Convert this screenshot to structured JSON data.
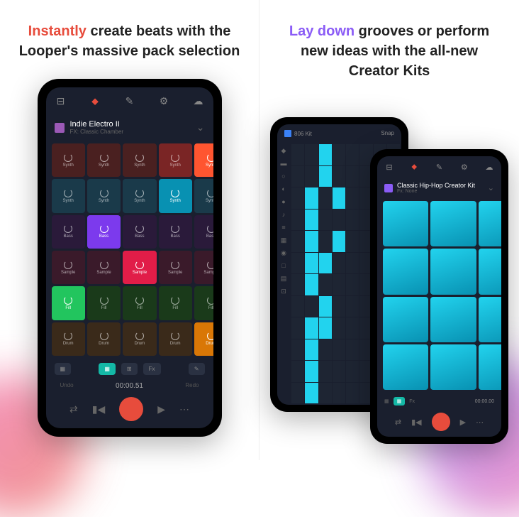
{
  "left": {
    "headline": {
      "highlight": "Instantly",
      "rest": " create beats with the Looper's massive pack selection"
    },
    "pack": {
      "name": "Indie Electro II",
      "fx": "FX: Classic Chamber"
    },
    "pads": [
      {
        "label": "Synth",
        "color": "#4a2020"
      },
      {
        "label": "Synth",
        "color": "#4a2020"
      },
      {
        "label": "Synth",
        "color": "#4a2020"
      },
      {
        "label": "Synth",
        "color": "#7a2525"
      },
      {
        "label": "Synth",
        "color": "#ff5530",
        "bright": true
      },
      {
        "label": "Synth",
        "color": "#1a3a4a"
      },
      {
        "label": "Synth",
        "color": "#1a3a4a"
      },
      {
        "label": "Synth",
        "color": "#1a3a4a"
      },
      {
        "label": "Synth",
        "color": "#0891b2",
        "bright": true
      },
      {
        "label": "Synth",
        "color": "#1a3a4a"
      },
      {
        "label": "Bass",
        "color": "#2a1a3a"
      },
      {
        "label": "Bass",
        "color": "#7c3aed",
        "bright": true
      },
      {
        "label": "Bass",
        "color": "#2a1a3a"
      },
      {
        "label": "Bass",
        "color": "#2a1a3a"
      },
      {
        "label": "Bass",
        "color": "#2a1a3a"
      },
      {
        "label": "Sample",
        "color": "#3a1a2a"
      },
      {
        "label": "Sample",
        "color": "#3a1a2a"
      },
      {
        "label": "Sample",
        "color": "#e11d48",
        "bright": true
      },
      {
        "label": "Sample",
        "color": "#3a1a2a"
      },
      {
        "label": "Sample",
        "color": "#3a1a2a"
      },
      {
        "label": "Fill",
        "color": "#22c55e",
        "bright": true
      },
      {
        "label": "Fill",
        "color": "#1a3a1a"
      },
      {
        "label": "Fill",
        "color": "#1a3a1a"
      },
      {
        "label": "Fill",
        "color": "#1a3a1a"
      },
      {
        "label": "Fill",
        "color": "#1a3a1a"
      },
      {
        "label": "Drum",
        "color": "#3a2a1a"
      },
      {
        "label": "Drum",
        "color": "#3a2a1a"
      },
      {
        "label": "Drum",
        "color": "#3a2a1a"
      },
      {
        "label": "Drum",
        "color": "#3a2a1a"
      },
      {
        "label": "Drum",
        "color": "#d97706",
        "bright": true
      }
    ],
    "fx_label": "Fx",
    "undo": "Undo",
    "redo": "Redo",
    "time": "00:00.51"
  },
  "right": {
    "headline": {
      "highlight": "Lay down",
      "rest": " grooves or perform new ideas with the all-new Creator Kits"
    },
    "sequencer": {
      "kit": "806 Kit",
      "snap": "Snap"
    },
    "creator": {
      "name": "Classic Hip-Hop Creator Kit",
      "fx": "Fx: None",
      "fx_label": "Fx",
      "time": "00:00.00"
    }
  }
}
